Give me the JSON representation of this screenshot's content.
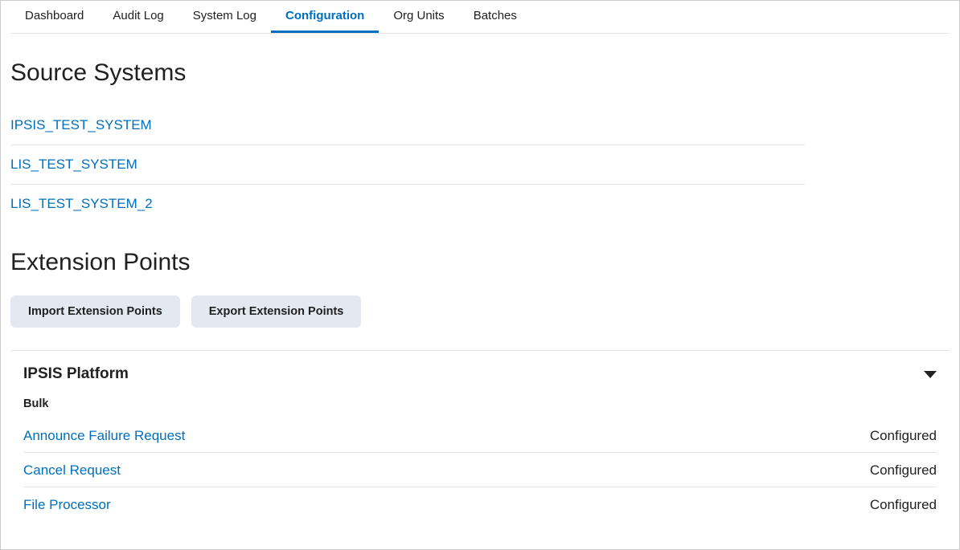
{
  "tabs": [
    {
      "label": "Dashboard",
      "active": false
    },
    {
      "label": "Audit Log",
      "active": false
    },
    {
      "label": "System Log",
      "active": false
    },
    {
      "label": "Configuration",
      "active": true
    },
    {
      "label": "Org Units",
      "active": false
    },
    {
      "label": "Batches",
      "active": false
    }
  ],
  "sections": {
    "source_systems": {
      "title": "Source Systems",
      "items": [
        {
          "name": "IPSIS_TEST_SYSTEM"
        },
        {
          "name": "LIS_TEST_SYSTEM"
        },
        {
          "name": "LIS_TEST_SYSTEM_2"
        }
      ]
    },
    "extension_points": {
      "title": "Extension Points",
      "buttons": {
        "import": "Import Extension Points",
        "export": "Export Extension Points"
      },
      "platform": {
        "title": "IPSIS Platform",
        "subgroup": "Bulk",
        "items": [
          {
            "name": "Announce Failure Request",
            "status": "Configured"
          },
          {
            "name": "Cancel Request",
            "status": "Configured"
          },
          {
            "name": "File Processor",
            "status": "Configured"
          }
        ]
      }
    }
  }
}
